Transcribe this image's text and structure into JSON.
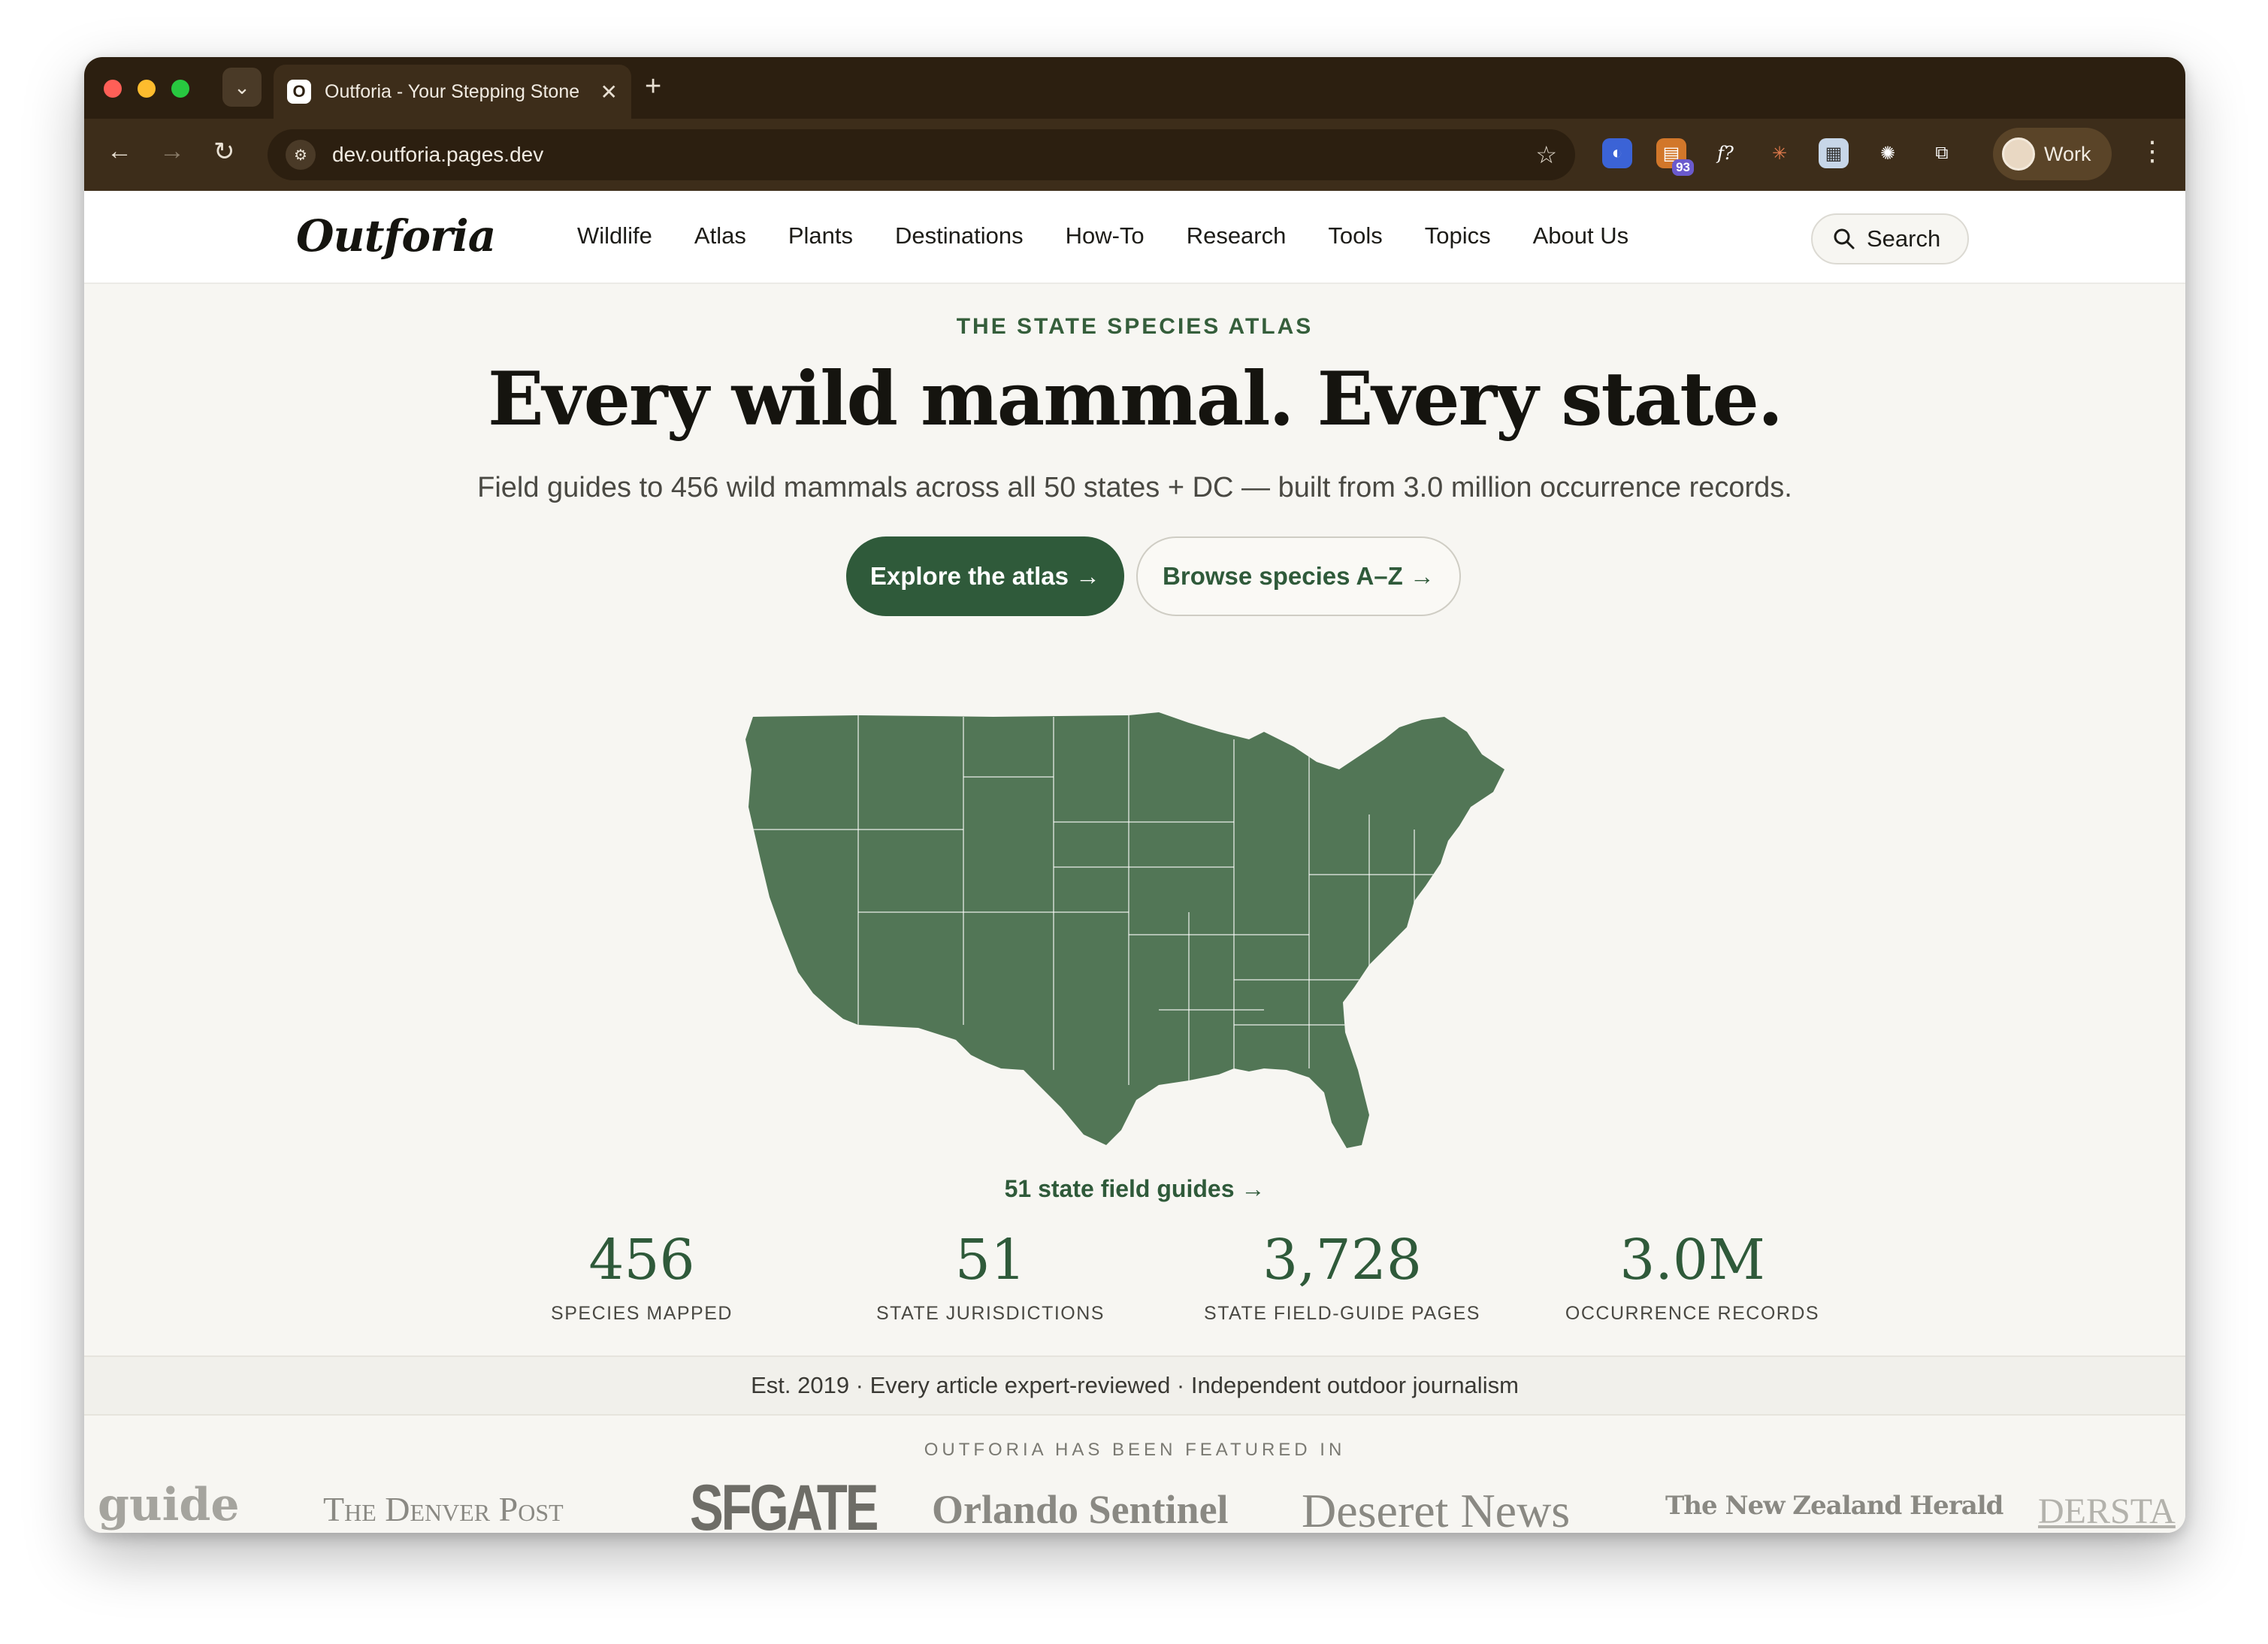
{
  "browser": {
    "tab_title": "Outforia - Your Stepping Stone",
    "url": "dev.outforia.pages.dev",
    "extension_badge": "93",
    "profile_label": "Work"
  },
  "site": {
    "logo": "Outforia",
    "nav": [
      "Wildlife",
      "Atlas",
      "Plants",
      "Destinations",
      "How-To",
      "Research",
      "Tools",
      "Topics",
      "About Us"
    ],
    "search_label": "Search"
  },
  "hero": {
    "eyebrow": "THE STATE SPECIES ATLAS",
    "title": "Every wild mammal. Every state.",
    "subtitle": "Field guides to 456 wild mammals across all 50 states + DC — built from 3.0 million occurrence records.",
    "cta_primary": "Explore the atlas →",
    "cta_secondary": "Browse species A–Z →"
  },
  "map": {
    "fill_color": "#527656",
    "link": "51 state field guides →"
  },
  "stats": [
    {
      "value": "456",
      "label": "SPECIES MAPPED"
    },
    {
      "value": "51",
      "label": "STATE JURISDICTIONS"
    },
    {
      "value": "3,728",
      "label": "STATE FIELD-GUIDE PAGES"
    },
    {
      "value": "3.0M",
      "label": "OCCURRENCE RECORDS"
    }
  ],
  "trust_bar": "Est. 2019 · Every article expert-reviewed · Independent outdoor journalism",
  "featured": {
    "title": "OUTFORIA HAS BEEN FEATURED IN",
    "logos": [
      "guide",
      "The Denver Post",
      "SFGATE",
      "Orlando Sentinel",
      "Deseret News",
      "The New Zealand Herald",
      "DERSTA"
    ]
  },
  "colors": {
    "accent": "#2f5a3a",
    "chrome": "#2c1f10",
    "background": "#f7f6f2"
  }
}
